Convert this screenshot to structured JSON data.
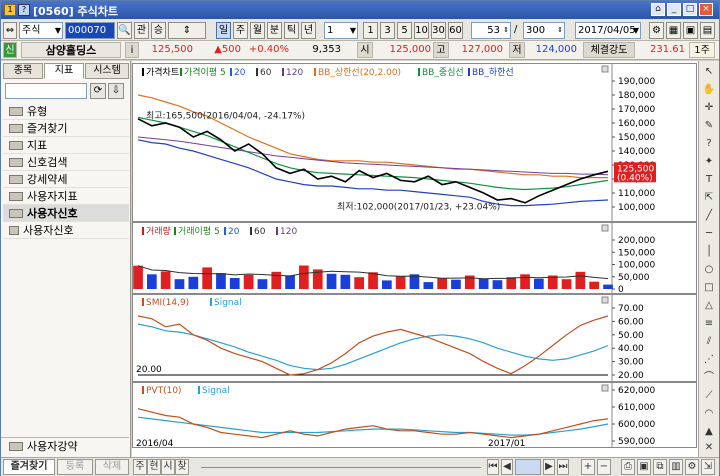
{
  "window": {
    "title": "[0560] 주식차트",
    "title_icon": "1",
    "title_icon2": "?"
  },
  "toolbar": {
    "market_select": "주식",
    "code_input": "000070",
    "btn_gwan": "관",
    "btn_sang": "승",
    "period_buttons": [
      "일",
      "주",
      "월",
      "분",
      "틱",
      "년"
    ],
    "period_selected": "일",
    "count_select": "1",
    "interval_buttons": [
      "1",
      "3",
      "5",
      "10",
      "30",
      "60"
    ],
    "zoom_value": "53",
    "range_sep": "/",
    "range_value": "300",
    "date_value": "2017/04/05"
  },
  "info": {
    "badge": "신",
    "name": "삼양홀딩스",
    "info_btn": "i",
    "price": "125,500",
    "change": "▲500",
    "change_pct": "+0.40%",
    "volume": "9,353",
    "open_label": "시",
    "open_value": "125,000",
    "high_label": "고",
    "high_value": "127,000",
    "low_label": "저",
    "low_value": "124,000",
    "strength_label": "체결강도",
    "strength_value": "231.61",
    "unit_btn": "1주"
  },
  "left_panel": {
    "tabs": [
      "종목",
      "지표",
      "시스템"
    ],
    "active_tab": "지표",
    "items": [
      "유형",
      "즐겨찾기",
      "지표",
      "신호검색",
      "강세약세",
      "사용자지표",
      "사용자신호",
      "사용자신호"
    ],
    "bottom_item": "사용자강약"
  },
  "statusbar": {
    "buttons": [
      "즐겨찾기",
      "등록",
      "삭제"
    ],
    "tabs": [
      "주",
      "현",
      "시",
      "찾"
    ]
  },
  "colors": {
    "up": "#e02020",
    "down": "#1a3fd8",
    "bb_upper": "#e07020",
    "bb_mid": "#109040",
    "bb_low": "#2040c0"
  },
  "chart_data": [
    {
      "type": "line",
      "legend": [
        "가격차트",
        "가격이평 5",
        "20",
        "60",
        "120",
        "BB_상한선(20,2.00)",
        "BB_중심선",
        "BB_하한선"
      ],
      "ylim": [
        100000,
        190000
      ],
      "yticks": [
        "190,000",
        "180,000",
        "170,000",
        "160,000",
        "150,000",
        "140,000",
        "130,000",
        "120,000",
        "110,000",
        "100,000"
      ],
      "price_tag": [
        "125,500",
        "(0.40%)"
      ],
      "annotation_high": "최고:165,500(2016/04/04, -24.17%)",
      "annotation_low": "최저:102,000(2017/01/23, +23.04%)",
      "price": [
        163000,
        158000,
        160000,
        157000,
        150000,
        154000,
        148000,
        140000,
        145000,
        138000,
        128000,
        124000,
        127000,
        120000,
        122000,
        118000,
        126000,
        121000,
        124000,
        119000,
        118000,
        122000,
        116000,
        118000,
        114000,
        110000,
        105000,
        106000,
        103000,
        108000,
        112000,
        116000,
        120000,
        123000,
        125500
      ],
      "ma120": [
        150000,
        149000,
        148000,
        147000,
        145500,
        144000,
        142500,
        141000,
        139500,
        138000,
        136500,
        135500,
        134500,
        133500,
        132500,
        131500,
        131000,
        130500,
        130000,
        129500,
        129000,
        128500,
        128000,
        127500,
        127000,
        126500,
        126000,
        125500,
        125000,
        124500,
        124000,
        124000,
        123500,
        123500,
        123000
      ],
      "bb_upper": [
        180000,
        178000,
        175000,
        172000,
        168000,
        165000,
        160000,
        155000,
        150000,
        146000,
        142000,
        138000,
        136000,
        134000,
        133000,
        133000,
        133000,
        132000,
        132000,
        131000,
        130000,
        129000,
        128000,
        127000,
        127000,
        126000,
        125000,
        124000,
        123000,
        123000,
        122000,
        122000,
        121000,
        121000,
        121000
      ],
      "bb_mid": [
        164000,
        162000,
        160000,
        157000,
        154000,
        151000,
        147000,
        143000,
        139000,
        135000,
        131000,
        128000,
        126000,
        124500,
        124000,
        123500,
        123000,
        122500,
        122000,
        121500,
        121000,
        120000,
        119000,
        118000,
        117000,
        115500,
        114000,
        113000,
        112500,
        113000,
        113500,
        114500,
        116000,
        117500,
        119000
      ],
      "bb_lower": [
        148000,
        146000,
        145000,
        142000,
        140000,
        137000,
        134000,
        131000,
        128000,
        124000,
        120000,
        118000,
        116000,
        115000,
        115000,
        114000,
        113000,
        113000,
        112000,
        112000,
        111000,
        110000,
        109000,
        108000,
        107000,
        104000,
        102000,
        101000,
        101000,
        101500,
        102000,
        103000,
        104000,
        104500,
        105000
      ]
    },
    {
      "type": "bar",
      "legend": [
        "거래량",
        "거래이평 5",
        "20",
        "60",
        "120"
      ],
      "ylim": [
        0,
        200000
      ],
      "yticks": [
        "200,000",
        "150,000",
        "100,000",
        "50,000",
        "0"
      ],
      "volume": [
        95000,
        60000,
        72000,
        40000,
        50000,
        88000,
        65000,
        45000,
        58000,
        40000,
        70000,
        55000,
        96000,
        80000,
        62000,
        58000,
        48000,
        68000,
        35000,
        52000,
        60000,
        28000,
        45000,
        38000,
        55000,
        42000,
        36000,
        48000,
        60000,
        42000,
        55000,
        40000,
        70000,
        30000,
        18000
      ],
      "up": [
        1,
        0,
        1,
        0,
        0,
        1,
        0,
        0,
        1,
        0,
        1,
        0,
        1,
        1,
        0,
        0,
        1,
        1,
        0,
        1,
        0,
        0,
        1,
        0,
        1,
        0,
        0,
        1,
        1,
        0,
        1,
        1,
        1,
        1,
        0
      ]
    },
    {
      "type": "line",
      "legend": [
        "SMI(14,9)",
        "Signal"
      ],
      "ylim": [
        20,
        70
      ],
      "yticks": [
        "70.00",
        "60.00",
        "50.00",
        "40.00",
        "30.00",
        "20.00"
      ],
      "baseline_label": "20.00",
      "smi": [
        64,
        62,
        56,
        58,
        50,
        46,
        40,
        36,
        33,
        30,
        25,
        20,
        21,
        24,
        29,
        36,
        44,
        49,
        52,
        54,
        51,
        48,
        44,
        40,
        36,
        30,
        25,
        21,
        27,
        34,
        42,
        50,
        57,
        61,
        64
      ],
      "signal": [
        58,
        56,
        53,
        52,
        50,
        47,
        44,
        41,
        37,
        34,
        31,
        27,
        25,
        24,
        25,
        28,
        32,
        36,
        40,
        44,
        47,
        49,
        50,
        49,
        47,
        44,
        40,
        37,
        34,
        32,
        31,
        32,
        35,
        38,
        42
      ]
    },
    {
      "type": "line",
      "legend": [
        "PVT(10)",
        "Signal"
      ],
      "ylim": [
        590000,
        620000
      ],
      "yticks": [
        "620,000",
        "610,000",
        "600,000",
        "590,000"
      ],
      "pvt": [
        609000,
        607000,
        605000,
        604000,
        600000,
        598000,
        595000,
        594000,
        593000,
        592000,
        594000,
        596000,
        594000,
        593000,
        595000,
        597000,
        598000,
        599000,
        597000,
        596000,
        596000,
        595000,
        594000,
        594000,
        595000,
        594000,
        593000,
        592000,
        593000,
        594000,
        596000,
        598000,
        600000,
        602000,
        603000
      ],
      "signal": [
        604000,
        603000,
        602000,
        601000,
        600000,
        599000,
        598000,
        597000,
        596000,
        595000,
        595000,
        595000,
        595000,
        595000,
        595500,
        596000,
        596500,
        597000,
        597000,
        597000,
        596500,
        596000,
        595500,
        595000,
        595000,
        594500,
        594000,
        593500,
        593500,
        594000,
        595000,
        596000,
        597000,
        598500,
        600000
      ],
      "x_labels": [
        "2016/04",
        "2017/01"
      ]
    }
  ]
}
